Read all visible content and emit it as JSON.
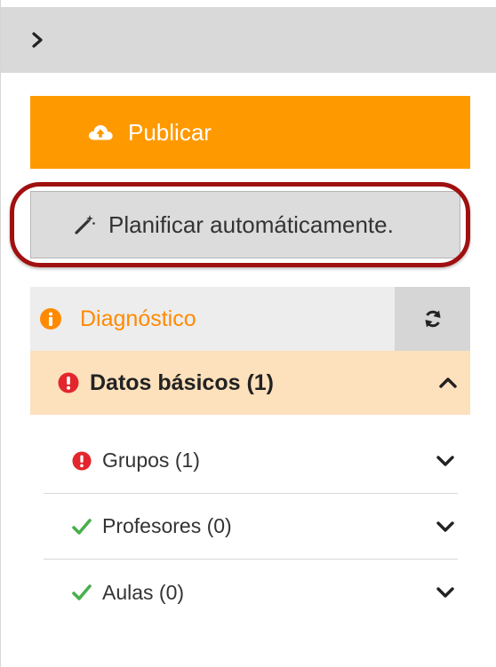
{
  "topbar": {
    "toggle_icon": "chevron-right-icon"
  },
  "actions": {
    "publish_label": "Publicar",
    "publish_icon": "cloud-upload-icon",
    "plan_label": "Planificar automáticamente.",
    "plan_icon": "magic-wand-icon"
  },
  "diagnostics": {
    "title": "Diagnóstico",
    "title_icon": "info-circle-icon",
    "refresh_icon": "refresh-icon",
    "section": {
      "label": "Datos básicos (1)",
      "status_icon": "exclamation-circle-icon",
      "expanded": true,
      "items": [
        {
          "label": "Grupos (1)",
          "status": "error",
          "icon": "exclamation-circle-icon"
        },
        {
          "label": "Profesores (0)",
          "status": "ok",
          "icon": "check-icon"
        },
        {
          "label": "Aulas (0)",
          "status": "ok",
          "icon": "check-icon"
        }
      ]
    }
  },
  "colors": {
    "accent_orange": "#ff9900",
    "diag_orange": "#ff8a00",
    "error_red": "#e3262d",
    "ok_green": "#47b04b",
    "highlight_ring": "#a01010",
    "section_bg": "#fde0bc"
  }
}
